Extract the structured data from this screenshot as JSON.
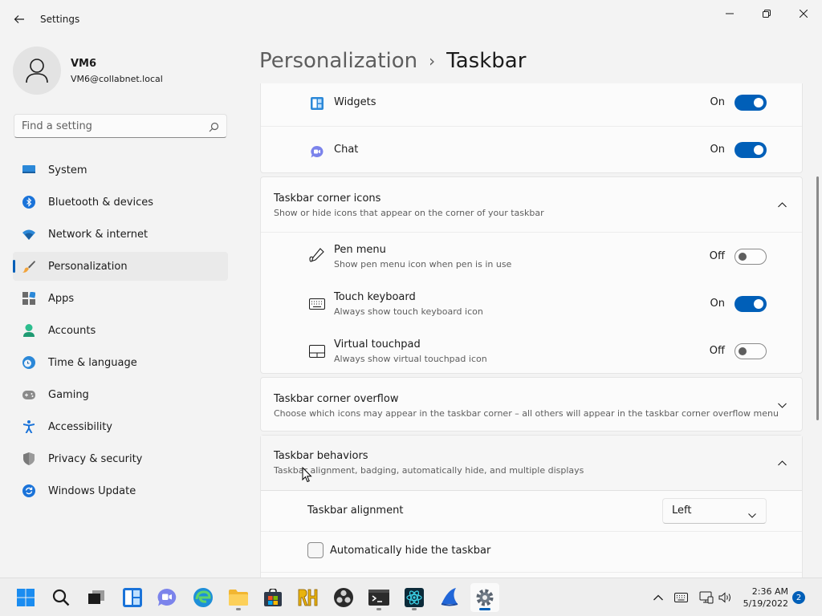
{
  "window": {
    "title": "Settings"
  },
  "profile": {
    "name": "VM6",
    "email": "VM6@collabnet.local"
  },
  "search": {
    "placeholder": "Find a setting"
  },
  "nav": {
    "items": [
      {
        "label": "System",
        "icon": "monitor-icon"
      },
      {
        "label": "Bluetooth & devices",
        "icon": "bluetooth-icon"
      },
      {
        "label": "Network & internet",
        "icon": "wifi-icon"
      },
      {
        "label": "Personalization",
        "icon": "brush-icon",
        "active": true
      },
      {
        "label": "Apps",
        "icon": "apps-icon"
      },
      {
        "label": "Accounts",
        "icon": "person-icon"
      },
      {
        "label": "Time & language",
        "icon": "clock-globe-icon"
      },
      {
        "label": "Gaming",
        "icon": "gamepad-icon"
      },
      {
        "label": "Accessibility",
        "icon": "accessibility-icon"
      },
      {
        "label": "Privacy & security",
        "icon": "shield-icon"
      },
      {
        "label": "Windows Update",
        "icon": "update-icon"
      }
    ]
  },
  "breadcrumb": {
    "parent": "Personalization",
    "separator": "›",
    "current": "Taskbar"
  },
  "taskbar_items": {
    "widgets": {
      "label": "Widgets",
      "state": "On"
    },
    "chat": {
      "label": "Chat",
      "state": "On"
    }
  },
  "corner_icons": {
    "title": "Taskbar corner icons",
    "subtitle": "Show or hide icons that appear on the corner of your taskbar",
    "pen": {
      "title": "Pen menu",
      "subtitle": "Show pen menu icon when pen is in use",
      "state": "Off"
    },
    "keyboard": {
      "title": "Touch keyboard",
      "subtitle": "Always show touch keyboard icon",
      "state": "On"
    },
    "touchpad": {
      "title": "Virtual touchpad",
      "subtitle": "Always show virtual touchpad icon",
      "state": "Off"
    }
  },
  "corner_overflow": {
    "title": "Taskbar corner overflow",
    "subtitle": "Choose which icons may appear in the taskbar corner – all others will appear in the taskbar corner overflow menu"
  },
  "behaviors": {
    "title": "Taskbar behaviors",
    "subtitle": "Taskbar alignment, badging, automatically hide, and multiple displays",
    "alignment": {
      "label": "Taskbar alignment",
      "value": "Left"
    },
    "autohide": {
      "label": "Automatically hide the taskbar",
      "checked": false
    }
  },
  "system_tray": {
    "time": "2:36 AM",
    "date": "5/19/2022",
    "notification_count": "2"
  },
  "colors": {
    "accent": "#005fb8",
    "background": "#f3f3f3",
    "card": "#fbfbfb"
  }
}
